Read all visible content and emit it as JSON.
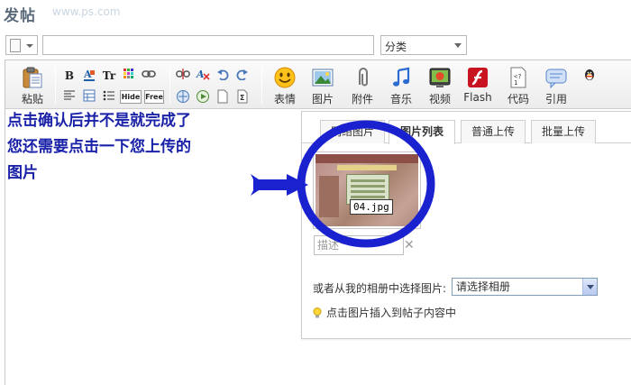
{
  "header": {
    "title": "发帖",
    "watermark": "www.ps.com"
  },
  "subject": {
    "value": "",
    "placeholder": ""
  },
  "category": {
    "selected": "分类"
  },
  "toolbar": {
    "paste_label": "粘贴",
    "bold": "B",
    "font_size": "Tr",
    "hide": "Hide",
    "free": "Free",
    "emoticon_label": "表情",
    "image_label": "图片",
    "attachment_label": "附件",
    "music_label": "音乐",
    "video_label": "视频",
    "flash_label": "Flash",
    "code_label": "代码",
    "quote_label": "引用"
  },
  "panel": {
    "tabs": [
      {
        "label": "网络图片",
        "active": false
      },
      {
        "label": "图片列表",
        "active": true
      },
      {
        "label": "普通上传",
        "active": false
      },
      {
        "label": "批量上传",
        "active": false
      }
    ],
    "image": {
      "filename": "04.jpg"
    },
    "description": {
      "placeholder": "描述"
    },
    "album_label": "或者从我的相册中选择图片:",
    "album_select": "请选择相册",
    "tip": "点击图片插入到帖子内容中"
  },
  "annotation": {
    "line1": "点击确认后并不是就完成了",
    "line2": "您还需要点击一下您上传的",
    "line3": "图片",
    "color": "#1a22a8"
  }
}
